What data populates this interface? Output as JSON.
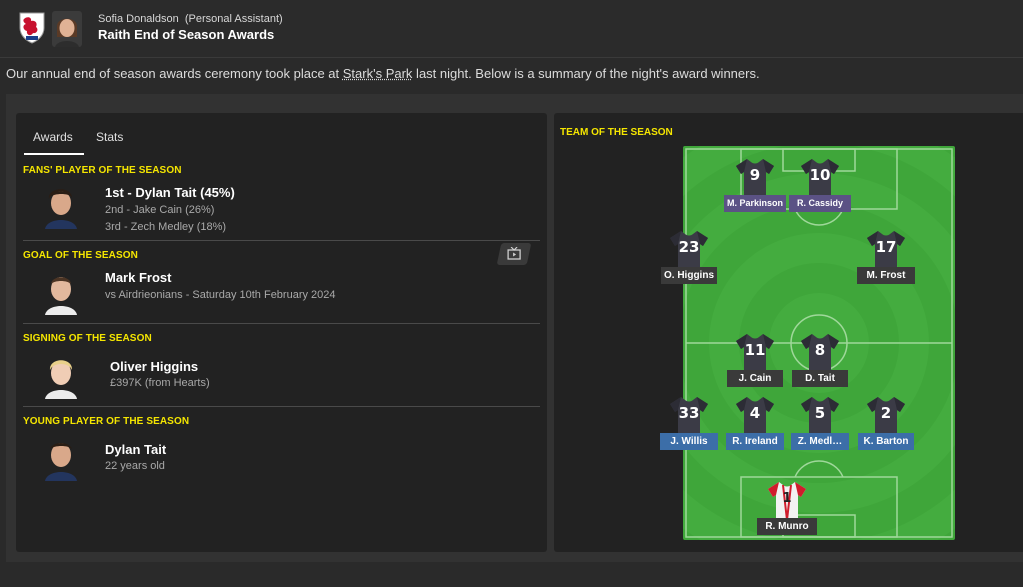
{
  "header": {
    "sender": "Sofia Donaldson",
    "sender_role": "(Personal Assistant)",
    "subject": "Raith End of Season Awards"
  },
  "intro": {
    "before": "Our annual end of season awards ceremony took place at ",
    "venue": "Stark's Park",
    "after": " last night. Below is a summary of the night's award winners."
  },
  "tabs": [
    {
      "label": "Awards",
      "active": true
    },
    {
      "label": "Stats",
      "active": false
    }
  ],
  "awards": [
    {
      "title": "FANS' PLAYER OF THE SEASON",
      "main": "1st - Dylan Tait (45%)",
      "lines": [
        "2nd - Jake Cain (26%)",
        "3rd - Zech Medley (18%)"
      ]
    },
    {
      "title": "GOAL OF THE SEASON",
      "main": "Mark Frost",
      "lines": [
        "vs Airdrieonians - Saturday 10th February 2024"
      ]
    },
    {
      "title": "SIGNING OF THE SEASON",
      "main": "Oliver Higgins",
      "lines": [
        "£397K (from Hearts)"
      ]
    },
    {
      "title": "YOUNG PLAYER OF THE SEASON",
      "main": "Dylan Tait",
      "lines": [
        "22 years old"
      ]
    }
  ],
  "team_of_season": {
    "title": "TEAM OF THE SEASON",
    "players": [
      {
        "number": "9",
        "name": "M. Parkinson",
        "role": "fwd"
      },
      {
        "number": "10",
        "name": "R. Cassidy",
        "role": "fwd"
      },
      {
        "number": "23",
        "name": "O. Higgins",
        "role": "mid"
      },
      {
        "number": "17",
        "name": "M. Frost",
        "role": "mid"
      },
      {
        "number": "11",
        "name": "J. Cain",
        "role": "mid"
      },
      {
        "number": "8",
        "name": "D. Tait",
        "role": "mid"
      },
      {
        "number": "33",
        "name": "J. Willis",
        "role": "def"
      },
      {
        "number": "4",
        "name": "R. Ireland",
        "role": "def"
      },
      {
        "number": "5",
        "name": "Z. Medl…",
        "role": "def"
      },
      {
        "number": "2",
        "name": "K. Barton",
        "role": "def"
      },
      {
        "number": "1",
        "name": "R. Munro",
        "role": "gk"
      }
    ]
  },
  "colors": {
    "accent_yellow": "#f5e600",
    "pitch_green": "#3fa63a",
    "fwd_label": "#5b5285",
    "def_label": "#3c6ea8"
  }
}
